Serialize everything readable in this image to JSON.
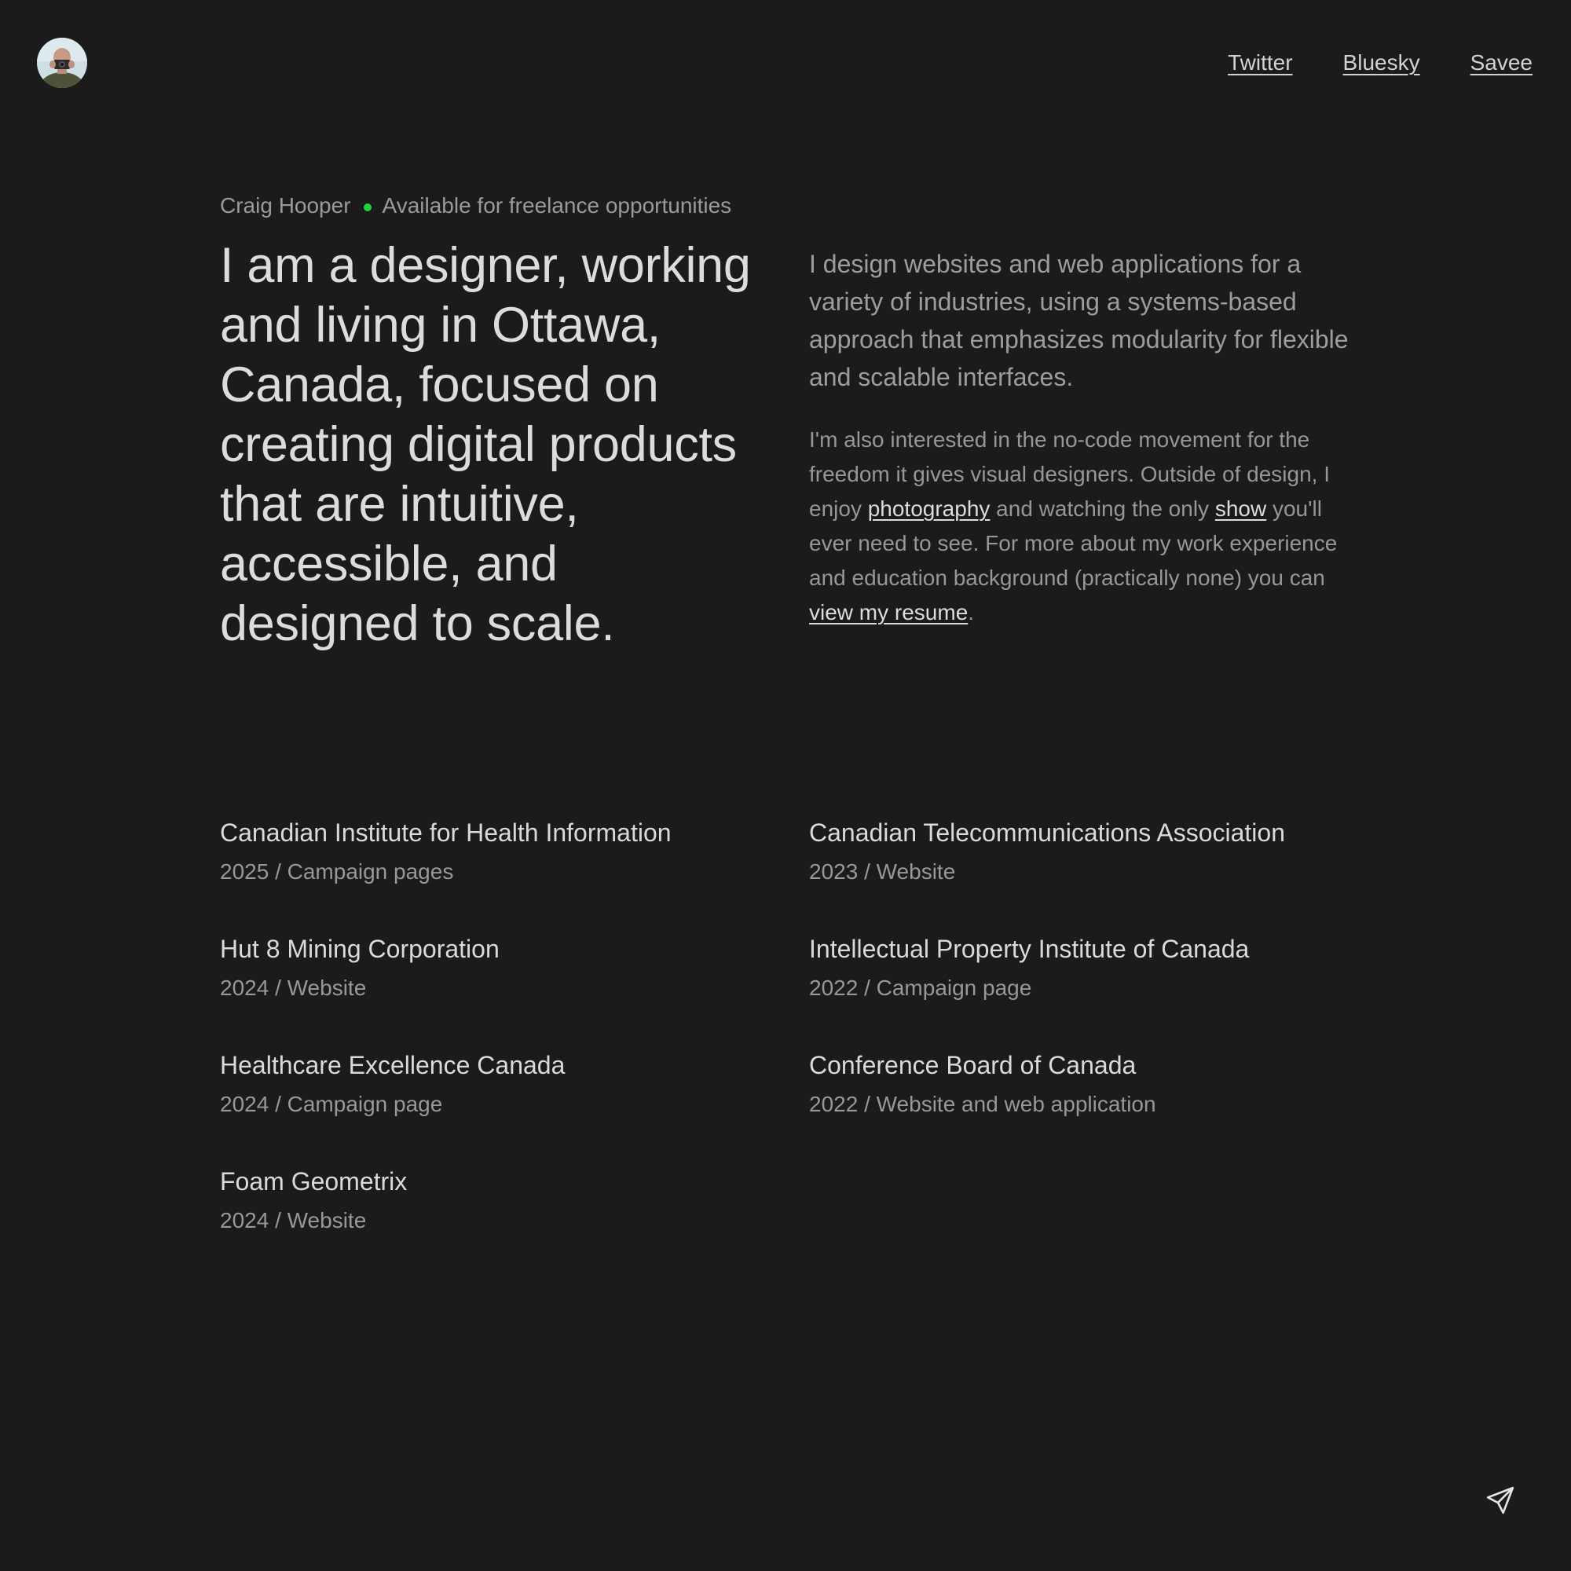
{
  "header": {
    "avatar_alt": "Craig Hooper avatar",
    "nav": [
      {
        "label": "Twitter"
      },
      {
        "label": "Bluesky"
      },
      {
        "label": "Savee"
      }
    ]
  },
  "intro": {
    "name": "Craig Hooper",
    "status_color": "#22d43a",
    "availability": "Available for freelance opportunities",
    "headline": "I am a designer, working and living in Ottawa, Canada, focused on creating digital products that are intuitive, accessible, and designed to scale."
  },
  "bio": {
    "lead": "I design websites and web applications for a variety of industries, using a systems-based approach that emphasizes modularity for flexible and scalable interfaces.",
    "p2_part1": "I'm also interested in the no-code movement for the freedom it gives visual designers. Outside of design, I enjoy ",
    "link_photography": "photography",
    "p2_part2": " and watching the only ",
    "link_show": "show",
    "p2_part3": " you'll ever need to see. For more about my work experience and education background (practically none) you can ",
    "link_resume": "view my resume",
    "p2_part4": "."
  },
  "projects": [
    {
      "name": "Canadian Institute for Health Information",
      "meta": "2025 / Campaign pages"
    },
    {
      "name": "Canadian Telecommunications Association",
      "meta": "2023 / Website"
    },
    {
      "name": "Hut 8 Mining Corporation",
      "meta": "2024 / Website"
    },
    {
      "name": "Intellectual Property Institute of Canada",
      "meta": "2022 / Campaign page"
    },
    {
      "name": "Healthcare Excellence Canada",
      "meta": "2024 / Campaign page"
    },
    {
      "name": "Conference Board of Canada",
      "meta": "2022 / Website and web application"
    },
    {
      "name": "Foam Geometrix",
      "meta": "2024 / Website"
    }
  ],
  "icons": {
    "avatar": "avatar-photo",
    "send": "send-icon"
  },
  "colors": {
    "background": "#1b1b1b",
    "text_primary": "#dcdcdc",
    "text_muted": "#999999",
    "status_dot": "#22d43a"
  }
}
